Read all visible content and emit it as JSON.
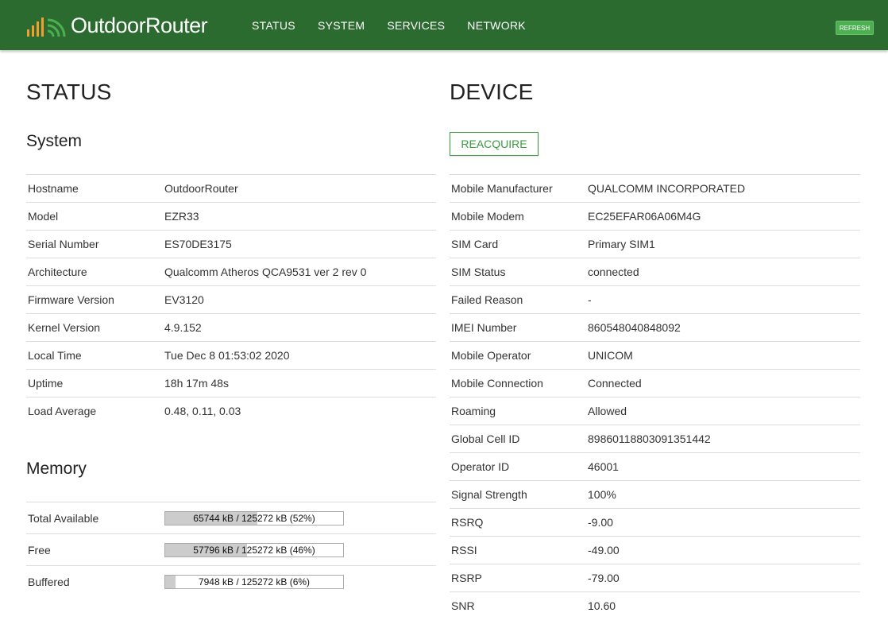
{
  "header": {
    "brand": "OutdoorRouter",
    "logo_icon": "signal-bars-icon",
    "nav": [
      "STATUS",
      "SYSTEM",
      "SERVICES",
      "NETWORK"
    ],
    "refresh_label": "REFRESH",
    "colors": {
      "bar": "#2c6b2f",
      "accent": "#4caf50",
      "logo": "#f0a030"
    }
  },
  "status": {
    "title": "STATUS",
    "system_title": "System",
    "system": [
      {
        "label": "Hostname",
        "value": "OutdoorRouter"
      },
      {
        "label": "Model",
        "value": "EZR33"
      },
      {
        "label": "Serial Number",
        "value": "ES70DE3175"
      },
      {
        "label": "Architecture",
        "value": "Qualcomm Atheros QCA9531 ver 2 rev 0"
      },
      {
        "label": "Firmware Version",
        "value": "EV3120"
      },
      {
        "label": "Kernel Version",
        "value": "4.9.152"
      },
      {
        "label": "Local Time",
        "value": "Tue Dec 8 01:53:02 2020"
      },
      {
        "label": "Uptime",
        "value": "18h 17m 48s"
      },
      {
        "label": "Load Average",
        "value": "0.48, 0.11, 0.03"
      }
    ],
    "memory_title": "Memory",
    "memory": [
      {
        "label": "Total Available",
        "text": "65744 kB / 125272 kB (52%)",
        "percent": 52
      },
      {
        "label": "Free",
        "text": "57796 kB / 125272 kB (46%)",
        "percent": 46
      },
      {
        "label": "Buffered",
        "text": "7948 kB / 125272 kB (6%)",
        "percent": 6
      }
    ]
  },
  "device": {
    "title": "DEVICE",
    "reacquire_label": "REACQUIRE",
    "rows": [
      {
        "label": "Mobile Manufacturer",
        "value": "QUALCOMM INCORPORATED"
      },
      {
        "label": "Mobile Modem",
        "value": "EC25EFAR06A06M4G"
      },
      {
        "label": "SIM Card",
        "value": "Primary SIM1"
      },
      {
        "label": "SIM Status",
        "value": "connected"
      },
      {
        "label": "Failed Reason",
        "value": "-"
      },
      {
        "label": "IMEI Number",
        "value": "860548040848092"
      },
      {
        "label": "Mobile Operator",
        "value": "UNICOM"
      },
      {
        "label": "Mobile Connection",
        "value": "Connected"
      },
      {
        "label": "Roaming",
        "value": "Allowed"
      },
      {
        "label": "Global Cell ID",
        "value": "89860118803091351442"
      },
      {
        "label": "Operator ID",
        "value": "46001"
      },
      {
        "label": "Signal Strength",
        "value": "100%"
      },
      {
        "label": "RSRQ",
        "value": "-9.00"
      },
      {
        "label": "RSSI",
        "value": "-49.00"
      },
      {
        "label": "RSRP",
        "value": "-79.00"
      },
      {
        "label": "SNR",
        "value": "10.60"
      }
    ]
  }
}
